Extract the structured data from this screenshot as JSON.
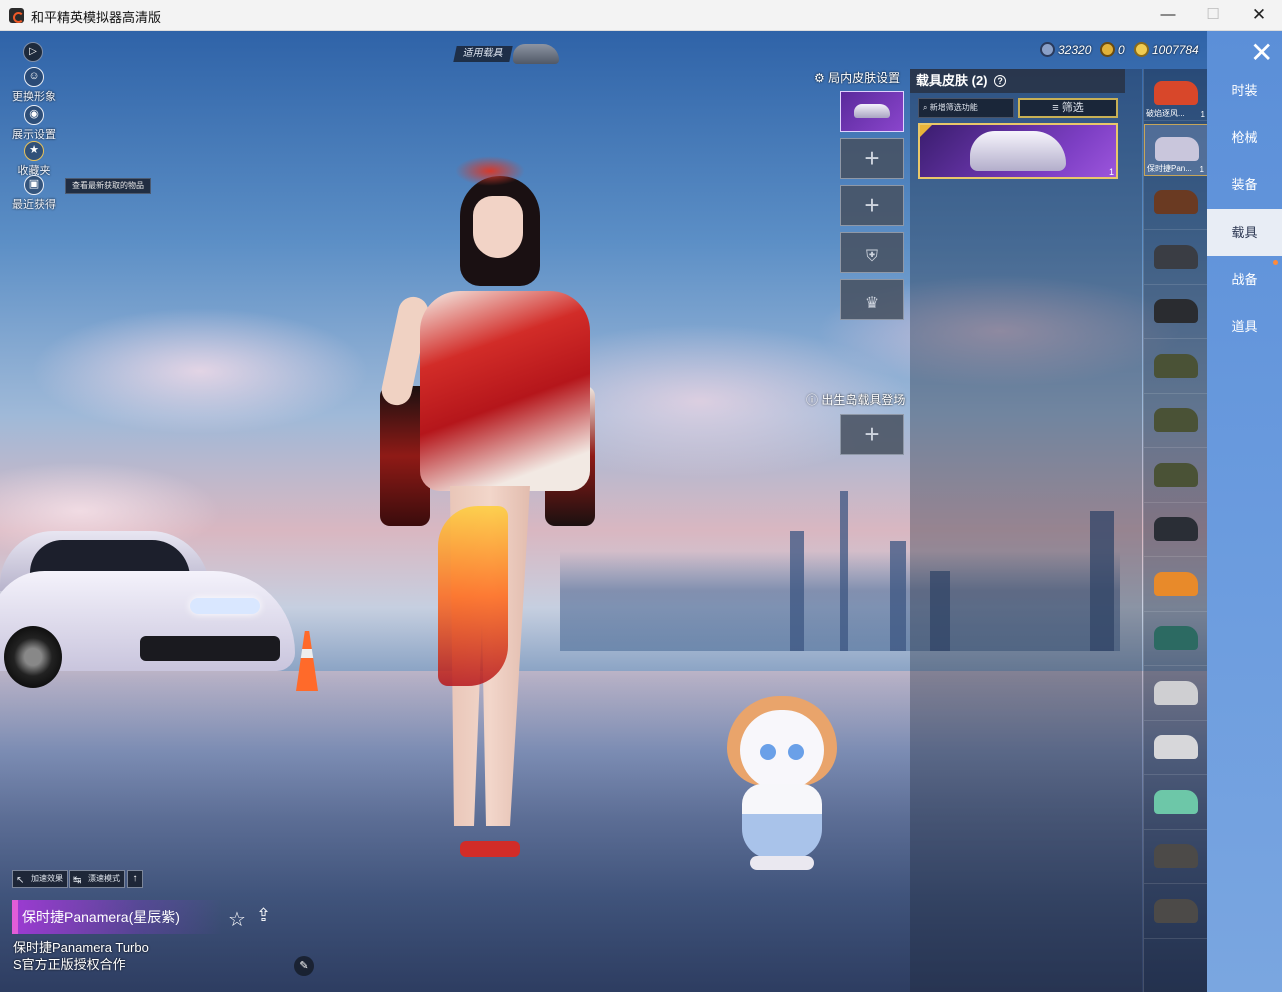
{
  "window": {
    "title": "和平精英模拟器高清版",
    "minimize_glyph": "—",
    "maximize_glyph": "☐",
    "close_glyph": "✕"
  },
  "left_menu": {
    "play_glyph": "▷",
    "items": [
      {
        "label": "更换形象",
        "icon": "person-icon"
      },
      {
        "label": "展示设置",
        "icon": "eye-icon"
      },
      {
        "label": "收藏夹",
        "icon": "badge-icon"
      },
      {
        "label": "最近获得",
        "icon": "gift-icon"
      }
    ],
    "tooltip": "查看最新获取的物品"
  },
  "top": {
    "applicable_vehicle": "适用载具"
  },
  "currency": [
    {
      "icon": "diamond-coin-icon",
      "value": "32320",
      "color": "#8aa0c8"
    },
    {
      "icon": "gold-a-coin-icon",
      "value": "0",
      "color": "#e1b23a"
    },
    {
      "icon": "gold-coin-icon",
      "value": "1007784",
      "color": "#f0cc52"
    }
  ],
  "skin_settings": {
    "title": "局内皮肤设置",
    "spawn_title": "出生岛载具登场",
    "plus": "+"
  },
  "panel": {
    "title": "载具皮肤 (2)",
    "help_glyph": "?",
    "search_label": "新增筛选功能",
    "filter_label": "筛选",
    "card_count": "1"
  },
  "vehicle_list": [
    {
      "label": "破焰逐风...",
      "count": "1",
      "color": "#d8472a"
    },
    {
      "label": "保时捷Pan...",
      "count": "1",
      "color": "#c9c6dc"
    },
    {
      "label": "",
      "count": "",
      "color": "#6a3a22"
    },
    {
      "label": "",
      "count": "",
      "color": "#3a3d44"
    },
    {
      "label": "",
      "count": "",
      "color": "#2a2c30"
    },
    {
      "label": "",
      "count": "",
      "color": "#4a5236"
    },
    {
      "label": "",
      "count": "",
      "color": "#4a5236"
    },
    {
      "label": "",
      "count": "",
      "color": "#4a5236"
    },
    {
      "label": "",
      "count": "",
      "color": "#2a2e36"
    },
    {
      "label": "",
      "count": "",
      "color": "#e88a2a"
    },
    {
      "label": "",
      "count": "",
      "color": "#2c6a62"
    },
    {
      "label": "",
      "count": "",
      "color": "#cfcfd2"
    },
    {
      "label": "",
      "count": "",
      "color": "#d7d7da"
    },
    {
      "label": "",
      "count": "",
      "color": "#6dc7a8"
    },
    {
      "label": "",
      "count": "",
      "color": "#4c4a48"
    },
    {
      "label": "",
      "count": "",
      "color": "#4c4a48"
    }
  ],
  "categories": [
    {
      "label": "时装",
      "active": false
    },
    {
      "label": "枪械",
      "active": false
    },
    {
      "label": "装备",
      "active": false
    },
    {
      "label": "载具",
      "active": true
    },
    {
      "label": "战备",
      "active": false
    },
    {
      "label": "道具",
      "active": false
    }
  ],
  "bottom": {
    "accel_effect": "加速效果",
    "drift_mode": "漂速模式",
    "skin_name": "保时捷Panamera(星辰紫)",
    "description_line1": "保时捷Panamera Turbo",
    "description_line2": "S官方正版授权合作"
  }
}
